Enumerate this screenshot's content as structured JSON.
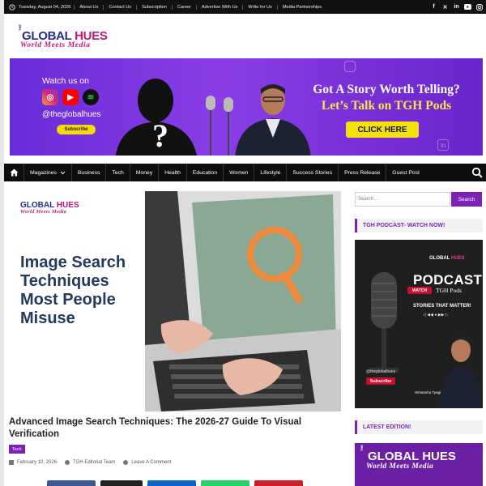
{
  "topbar": {
    "date": "Tuesday, August 04, 2026",
    "links": [
      "About Us",
      "Contact Us",
      "Subscription",
      "Career",
      "Advertise With Us",
      "Write for Us",
      "Media Partnerships"
    ],
    "social_icons": [
      "facebook-icon",
      "x-icon",
      "linkedin-icon",
      "youtube-icon",
      "instagram-icon"
    ]
  },
  "logo": {
    "title_part1": "GLOBAL ",
    "title_part2": "HUES",
    "tagline": "World Meets Media",
    "the": "THE"
  },
  "banner": {
    "watch_label": "Watch us on",
    "handle": "@theglobalhues",
    "subscribe_label": "Subscribe",
    "headline_1": "Got A Story Worth Telling?",
    "headline_2": "Let’s Talk on TGH Pods",
    "cta_label": "CLICK HERE",
    "colors": {
      "bg": "#7a33e0",
      "cta": "#f5e10a",
      "headline2": "#ffe14a"
    }
  },
  "nav": {
    "items": [
      "Magazines",
      "Business",
      "Tech",
      "Money",
      "Health",
      "Education",
      "Women",
      "Lifestyle",
      "Success Stories",
      "Press Release",
      "Guest Post"
    ]
  },
  "hero": {
    "logo_part1": "GLOBAL ",
    "logo_part2": "HUES",
    "logo_tagline": "World Meets Media",
    "text": "Image Search Techniques Most People Misuse"
  },
  "article": {
    "title": "Advanced Image Search Techniques: The 2026-27 Guide To Visual Verification",
    "category": "Tech",
    "date": "February 10, 2026",
    "author": "TGH Editorial Team",
    "comment": "Leave A Comment"
  },
  "sidebar": {
    "search_placeholder": "Search …",
    "search_button": "Search",
    "podcast_heading": "TGH PODCAST- WATCH NOW!",
    "podcast": {
      "logo_part1": "GLOBAL ",
      "logo_part2": "HUES",
      "word": "PODCAST",
      "watch": "WATCH",
      "tgh": "TGH Pods",
      "matter": "STORIES THAT MATTER!",
      "handle": "@theglobalhues",
      "subscribe": "Subscribe",
      "host": "Himanshu Tyagi"
    },
    "latest_heading": "LATEST EDITION!",
    "latest": {
      "the": "THE",
      "title": "GLOBAL HUES",
      "tagline": "World Meets Media"
    }
  },
  "accent_color": "#7d22b9"
}
